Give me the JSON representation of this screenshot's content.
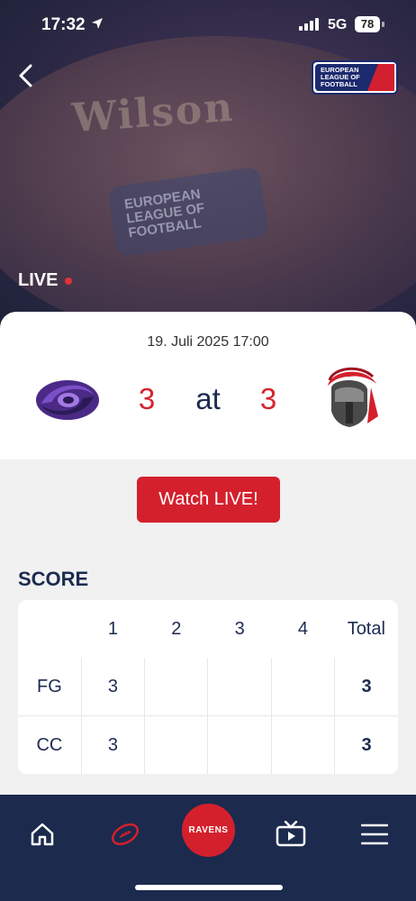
{
  "status_bar": {
    "time": "17:32",
    "network": "5G",
    "battery": "78"
  },
  "hero": {
    "ball_brand": "Wilson",
    "ball_logo_lines": [
      "EUROPEAN",
      "LEAGUE OF",
      "FOOTBALL"
    ],
    "league_logo_lines": [
      "EUROPEAN",
      "LEAGUE OF",
      "FOOTBALL"
    ],
    "live_label": "LIVE"
  },
  "match": {
    "datetime": "19. Juli 2025 17:00",
    "home_score": "3",
    "separator": "at",
    "away_score": "3"
  },
  "watch_button": "Watch LIVE!",
  "score_section": {
    "title": "SCORE",
    "headers": [
      "",
      "1",
      "2",
      "3",
      "4",
      "Total"
    ],
    "rows": [
      {
        "team": "FG",
        "quarters": [
          "3",
          "",
          "",
          ""
        ],
        "total": "3"
      },
      {
        "team": "CC",
        "quarters": [
          "3",
          "",
          "",
          ""
        ],
        "total": "3"
      }
    ]
  },
  "tab_bar": {
    "center_label": "RAVENS"
  },
  "colors": {
    "accent_red": "#d4202d",
    "navy": "#1c2a4e",
    "score_red": "#d6232e"
  },
  "icons": [
    "location-arrow-icon",
    "signal-icon",
    "back-chevron-icon",
    "home-icon",
    "football-icon",
    "tv-icon",
    "menu-icon"
  ]
}
